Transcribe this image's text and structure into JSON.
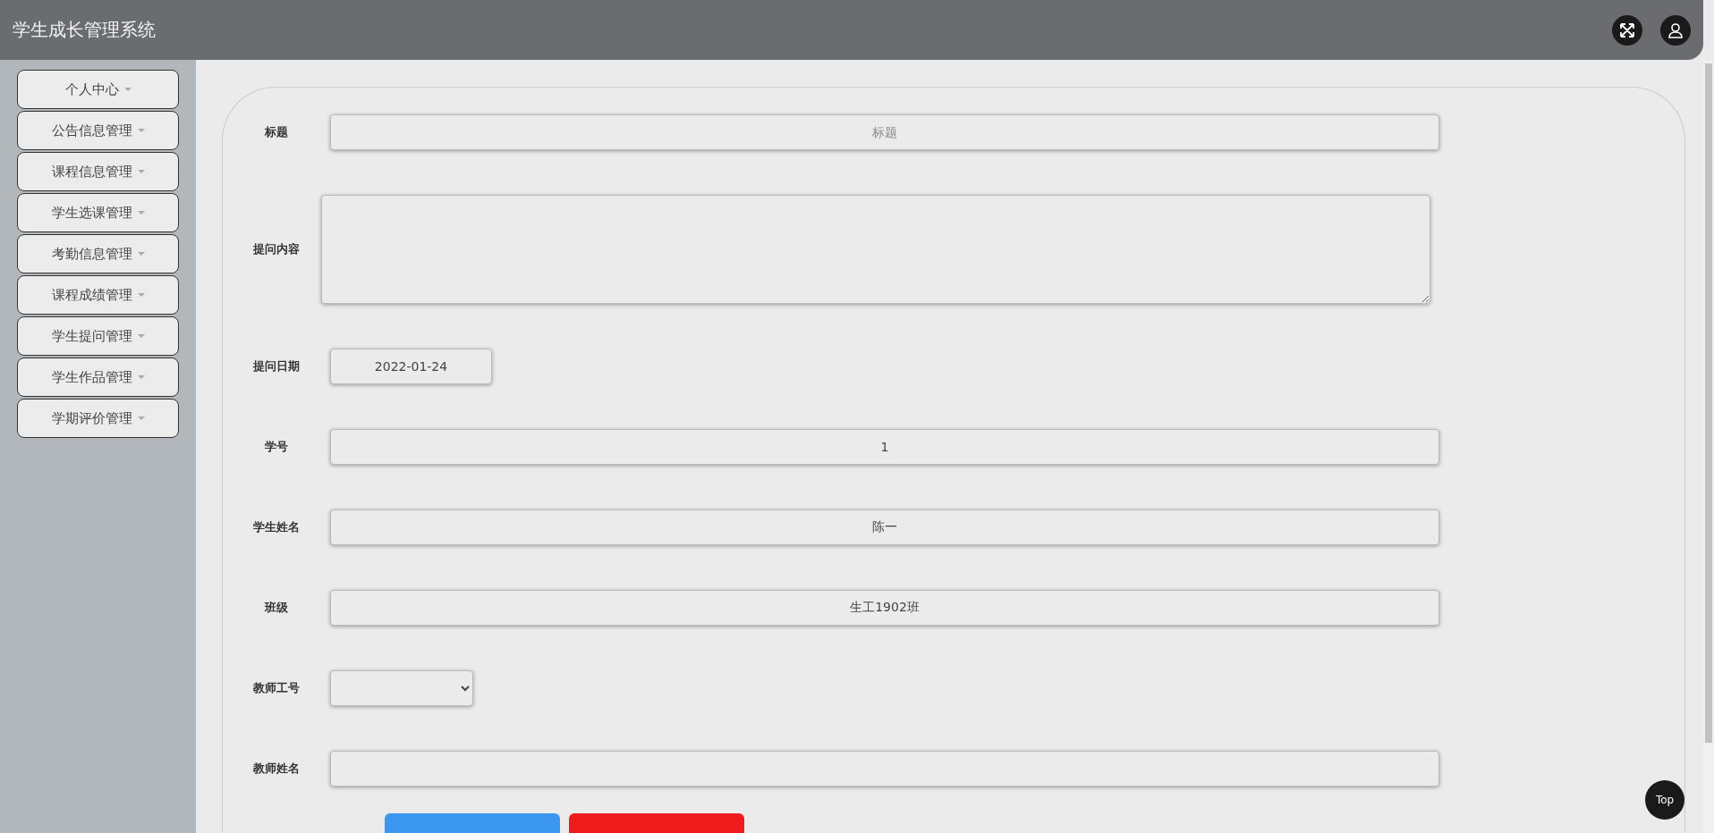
{
  "header": {
    "title": "学生成长管理系统"
  },
  "sidebar": {
    "items": [
      {
        "label": "个人中心"
      },
      {
        "label": "公告信息管理"
      },
      {
        "label": "课程信息管理"
      },
      {
        "label": "学生选课管理"
      },
      {
        "label": "考勤信息管理"
      },
      {
        "label": "课程成绩管理"
      },
      {
        "label": "学生提问管理"
      },
      {
        "label": "学生作品管理"
      },
      {
        "label": "学期评价管理"
      }
    ]
  },
  "form": {
    "fields": [
      {
        "kind": "input",
        "label": "标题",
        "placeholder": "标题"
      },
      {
        "kind": "textarea",
        "label": "提问内容"
      },
      {
        "kind": "date",
        "label": "提问日期",
        "value": "2022-01-24"
      },
      {
        "kind": "input",
        "label": "学号",
        "value": "1"
      },
      {
        "kind": "input",
        "label": "学生姓名",
        "value": "陈一"
      },
      {
        "kind": "input",
        "label": "班级",
        "value": "生工1902班"
      },
      {
        "kind": "select",
        "label": "教师工号"
      },
      {
        "kind": "input",
        "label": "教师姓名"
      }
    ],
    "buttons": [
      {
        "kind": "primary"
      },
      {
        "kind": "danger"
      }
    ]
  },
  "back_to_top": {
    "label": "Top"
  }
}
